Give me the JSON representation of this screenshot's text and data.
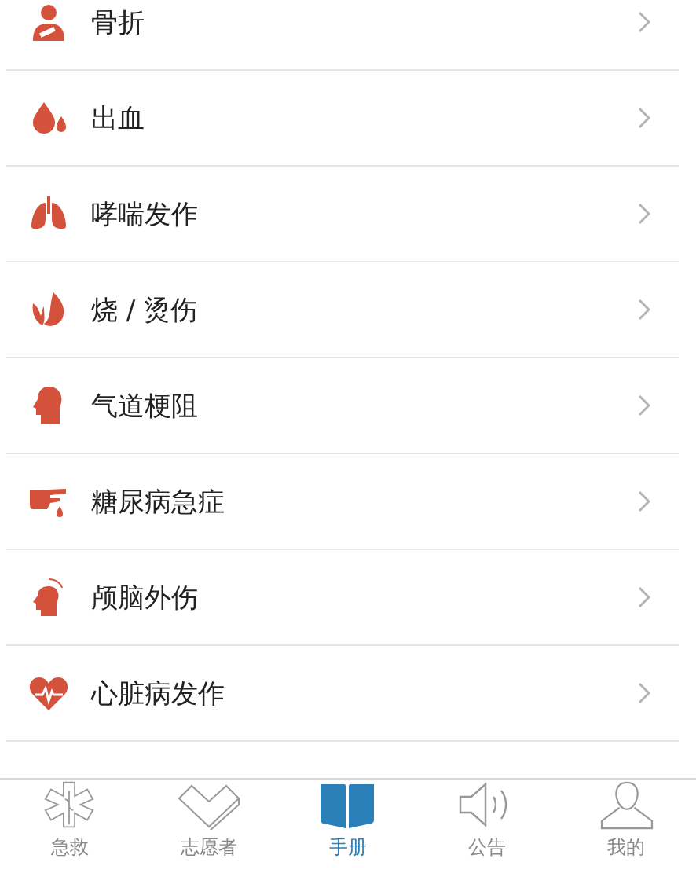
{
  "items": [
    {
      "label": "骨折"
    },
    {
      "label": "出血"
    },
    {
      "label": "哮喘发作"
    },
    {
      "label": "烧 / 烫伤"
    },
    {
      "label": "气道梗阻"
    },
    {
      "label": "糖尿病急症"
    },
    {
      "label": "颅脑外伤"
    },
    {
      "label": "心脏病发作"
    }
  ],
  "tabs": [
    {
      "label": "急救",
      "selected": false
    },
    {
      "label": "志愿者",
      "selected": false
    },
    {
      "label": "手册",
      "selected": true
    },
    {
      "label": "公告",
      "selected": false
    },
    {
      "label": "我的",
      "selected": false
    }
  ]
}
